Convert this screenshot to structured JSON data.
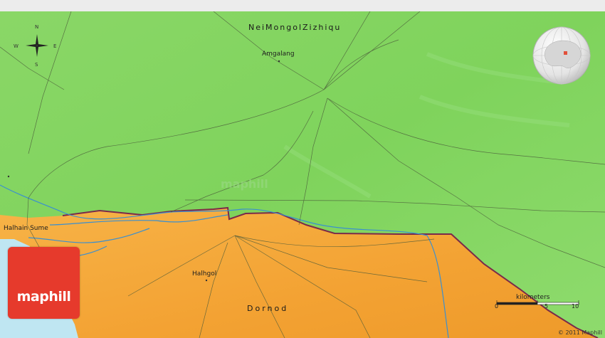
{
  "region_labels": {
    "north": "NeiMongolZizhiqu",
    "south": "Dornod"
  },
  "places": [
    {
      "name": "Amgalang"
    },
    {
      "name": "Halhgol"
    },
    {
      "name": "Halhain Sume"
    }
  ],
  "compass": {
    "n": "N",
    "s": "S",
    "e": "E",
    "w": "W"
  },
  "scale": {
    "title": "kilometers",
    "start": "0",
    "mid": "5",
    "end": "10"
  },
  "logo": {
    "text": "maphill"
  },
  "copyright": "© 2011 Maphill",
  "colors": {
    "north_land": "#7fd35c",
    "south_land": "#f3a233",
    "water": "#bfe6f2",
    "border": "#7a2a4a",
    "river": "#3a8fd0",
    "logo": "#e63a2c"
  },
  "icons": [
    "compass-rose-icon",
    "locator-globe-icon",
    "city-dot-icon"
  ]
}
